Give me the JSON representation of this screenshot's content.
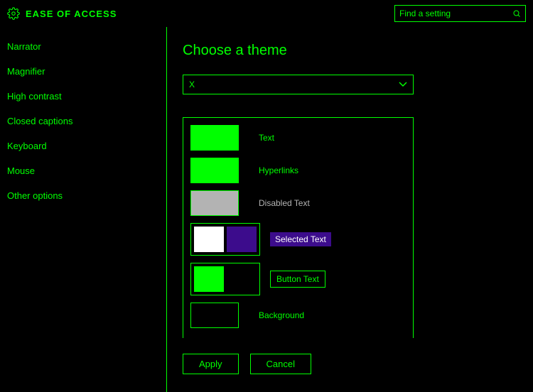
{
  "header": {
    "title": "EASE OF ACCESS",
    "search_placeholder": "Find a setting"
  },
  "sidebar": {
    "items": [
      {
        "label": "Narrator"
      },
      {
        "label": "Magnifier"
      },
      {
        "label": "High contrast"
      },
      {
        "label": "Closed captions"
      },
      {
        "label": "Keyboard"
      },
      {
        "label": "Mouse"
      },
      {
        "label": "Other options"
      }
    ]
  },
  "main": {
    "section_title": "Choose a theme",
    "dropdown_value": "X",
    "preview": {
      "text_label": "Text",
      "hyperlinks_label": "Hyperlinks",
      "disabled_label": "Disabled Text",
      "selected_label": "Selected Text",
      "button_text_label": "Button Text",
      "background_label": "Background",
      "colors": {
        "text": "#00ff00",
        "hyperlinks": "#00ff00",
        "disabled": "#b3b3b3",
        "selected_fg": "#ffffff",
        "selected_bg": "#3c0c8c",
        "button_fg": "#00ff00",
        "button_bg": "#000000",
        "background": "#000000"
      }
    },
    "apply_label": "Apply",
    "cancel_label": "Cancel"
  }
}
